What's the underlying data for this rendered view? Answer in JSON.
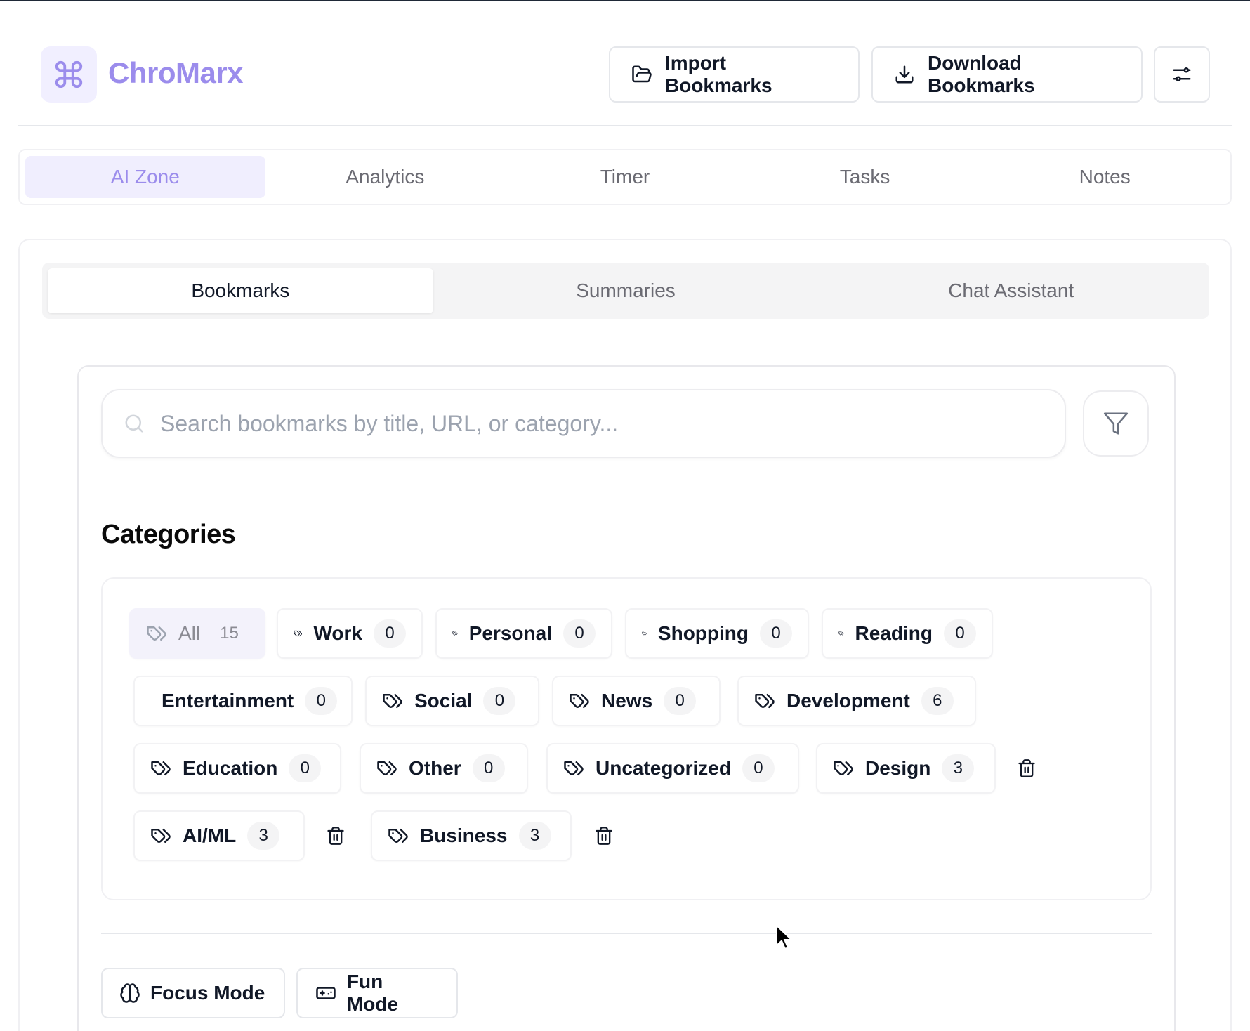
{
  "app": {
    "name": "ChroMarx",
    "brand_color": "#9b8cec"
  },
  "header": {
    "import_label": "Import Bookmarks",
    "download_label": "Download Bookmarks"
  },
  "main_tabs": [
    {
      "label": "AI Zone",
      "active": true
    },
    {
      "label": "Analytics",
      "active": false
    },
    {
      "label": "Timer",
      "active": false
    },
    {
      "label": "Tasks",
      "active": false
    },
    {
      "label": "Notes",
      "active": false
    }
  ],
  "sub_tabs": [
    {
      "label": "Bookmarks",
      "active": true
    },
    {
      "label": "Summaries",
      "active": false
    },
    {
      "label": "Chat Assistant",
      "active": false
    }
  ],
  "search": {
    "placeholder": "Search bookmarks by title, URL, or category...",
    "value": ""
  },
  "categories": {
    "title": "Categories",
    "items": [
      {
        "label": "All",
        "count": "15",
        "active": true
      },
      {
        "label": "Work",
        "count": "0"
      },
      {
        "label": "Personal",
        "count": "0"
      },
      {
        "label": "Shopping",
        "count": "0"
      },
      {
        "label": "Reading",
        "count": "0"
      },
      {
        "label": "Entertainment",
        "count": "0"
      },
      {
        "label": "Social",
        "count": "0"
      },
      {
        "label": "News",
        "count": "0"
      },
      {
        "label": "Development",
        "count": "6"
      },
      {
        "label": "Education",
        "count": "0"
      },
      {
        "label": "Other",
        "count": "0"
      },
      {
        "label": "Uncategorized",
        "count": "0"
      },
      {
        "label": "Design",
        "count": "3",
        "deletable": true
      },
      {
        "label": "AI/ML",
        "count": "3",
        "deletable": true
      },
      {
        "label": "Business",
        "count": "3",
        "deletable": true
      }
    ]
  },
  "modes": {
    "focus_label": "Focus Mode",
    "fun_label": "Fun Mode"
  },
  "icons": {
    "logo": "command-icon",
    "import": "folder-open-icon",
    "download": "download-icon",
    "settings": "sliders-icon",
    "search": "search-icon",
    "filter": "filter-icon",
    "category": "tags-icon",
    "delete": "trash-icon",
    "focus": "brain-icon",
    "fun": "gamepad-icon"
  }
}
